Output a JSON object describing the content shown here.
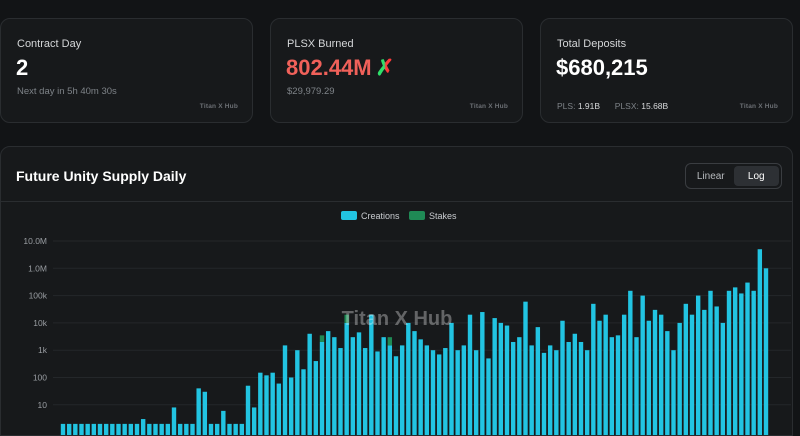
{
  "cards": [
    {
      "label": "Contract Day",
      "value": "2",
      "sub": "Next day in 5h 40m 30s",
      "brand": "Titan X Hub"
    },
    {
      "label": "PLSX Burned",
      "value": "802.44M",
      "sub": "$29,979.29",
      "brand": "Titan X Hub",
      "icon": "x-logo-icon"
    },
    {
      "label": "Total Deposits",
      "value": "$680,215",
      "brand": "Titan X Hub",
      "sub_parts": [
        {
          "k": "PLS:",
          "v": "1.91B"
        },
        {
          "k": "PLSX:",
          "v": "15.68B"
        }
      ]
    }
  ],
  "chart_panel": {
    "title": "Future Unity Supply Daily",
    "toggle": {
      "options": [
        "Linear",
        "Log"
      ],
      "selected": "Log"
    },
    "watermark": "Titan X Hub"
  },
  "colors": {
    "creations": "#22c4e2",
    "stakes": "#1f8a55",
    "burn_red": "#f0615a"
  },
  "chart_data": {
    "type": "bar",
    "stacked": true,
    "log_scale": true,
    "legend": {
      "placement": "top-center",
      "entries": [
        "Creations",
        "Stakes"
      ]
    },
    "y_ticks": [
      "10.0M",
      "1.0M",
      "100k",
      "10k",
      "1k",
      "100",
      "10"
    ],
    "y_tick_values": [
      10000000,
      1000000,
      100000,
      10000,
      1000,
      100,
      10
    ],
    "series": [
      {
        "name": "Creations",
        "values": [
          2,
          2,
          2,
          2,
          2,
          2,
          2,
          2,
          2,
          2,
          2,
          2,
          2,
          3,
          2,
          2,
          2,
          2,
          8,
          2,
          2,
          2,
          40,
          30,
          2,
          2,
          6,
          2,
          2,
          2,
          50,
          8,
          150,
          120,
          150,
          60,
          1500,
          100,
          1000,
          200,
          4000,
          400,
          2000,
          5000,
          3000,
          1200,
          10000,
          3000,
          4500,
          1200,
          20000,
          900,
          3000,
          1500,
          600,
          1500,
          10000,
          5000,
          2500,
          1500,
          1000,
          700,
          1200,
          10000,
          1000,
          1500,
          20000,
          1000,
          25000,
          500,
          15000,
          10000,
          8000,
          2000,
          3000,
          60000,
          1500,
          7000,
          800,
          1500,
          1000,
          12000,
          2000,
          4000,
          2000,
          1000,
          50000,
          12000,
          20000,
          3000,
          3500,
          20000,
          150000,
          3000,
          100000,
          12000,
          30000,
          20000,
          5000,
          1000,
          10000,
          50000,
          20000,
          100000,
          30000,
          150000,
          40000,
          10000,
          150000,
          200000,
          120000,
          300000,
          150000,
          5000000,
          1000000
        ]
      },
      {
        "name": "Stakes",
        "values": [
          0,
          0,
          0,
          0,
          0,
          0,
          0,
          0,
          0,
          0,
          0,
          0,
          0,
          0,
          0,
          0,
          0,
          0,
          0,
          0,
          0,
          0,
          0,
          0,
          0,
          0,
          0,
          0,
          0,
          0,
          0,
          0,
          0,
          0,
          0,
          0,
          0,
          0,
          0,
          0,
          0,
          0,
          1500,
          0,
          0,
          0,
          10000,
          0,
          0,
          0,
          0,
          0,
          0,
          1500,
          0,
          0,
          0,
          0,
          0,
          0,
          0,
          0,
          0,
          0,
          0,
          0,
          0,
          0,
          0,
          0,
          0,
          0,
          0,
          0,
          0,
          0,
          0,
          0,
          0,
          0,
          0,
          0,
          0,
          0,
          0,
          0,
          0,
          0,
          0,
          0,
          0,
          0,
          0,
          0,
          0,
          0,
          0,
          0,
          0,
          0,
          0,
          0,
          0,
          0,
          0,
          0,
          0,
          0,
          0,
          0,
          0,
          0,
          0,
          0,
          0
        ]
      }
    ],
    "visible_y_range": [
      2,
      10000000
    ]
  }
}
